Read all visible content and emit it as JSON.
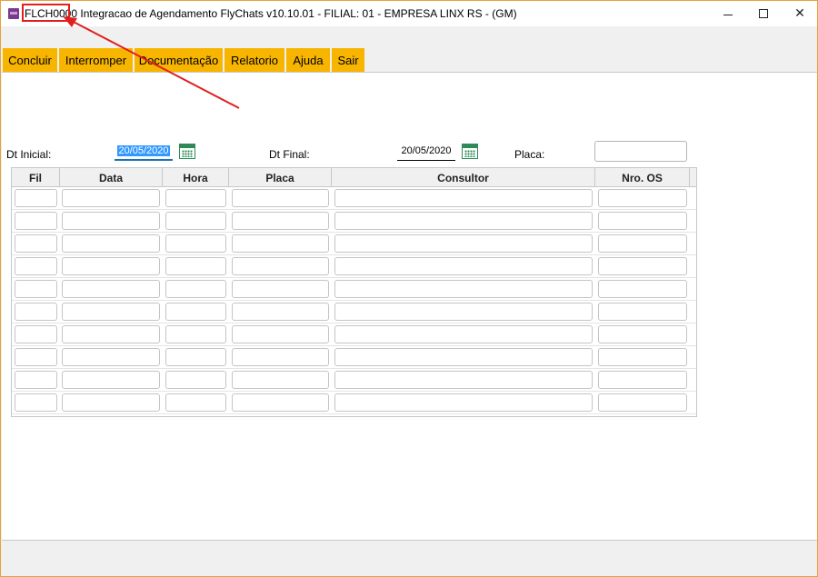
{
  "window": {
    "title_code": "FLCH0000",
    "title_rest": " Integracao de Agendamento FlyChats v10.10.01   - FILIAL: 01 - EMPRESA LINX RS - (GM)",
    "minimize": "—",
    "maximize": "☐",
    "close": "✕"
  },
  "toolbar": {
    "tabs": [
      "Concluir",
      "Interromper",
      "Documentação",
      "Relatorio",
      "Ajuda",
      "Sair"
    ]
  },
  "filters": {
    "dt_inicial_label": "Dt Inicial:",
    "dt_inicial_value": "20/05/2020",
    "dt_final_label": "Dt Final:",
    "dt_final_value": "20/05/2020",
    "placa_label": "Placa:",
    "placa_value": ""
  },
  "grid": {
    "columns": [
      "Fil",
      "Data",
      "Hora",
      "Placa",
      "Consultor",
      "Nro. OS"
    ],
    "row_count": 10
  },
  "colors": {
    "tab_bg": "#f7b500",
    "highlight": "#e02020",
    "accent": "#3399ff",
    "calendar": "#2e8b57"
  },
  "icons": {
    "app": "app-icon",
    "calendar": "calendar-icon"
  }
}
